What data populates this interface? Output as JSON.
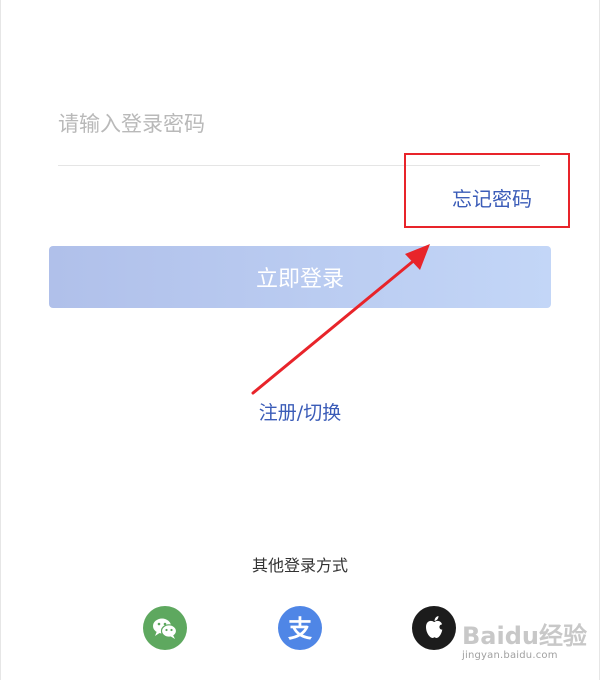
{
  "password": {
    "placeholder": "请输入登录密码",
    "value": ""
  },
  "forgot_password": {
    "label": "忘记密码"
  },
  "login_button": {
    "label": "立即登录"
  },
  "register_switch": {
    "label": "注册/切换"
  },
  "other_login": {
    "title": "其他登录方式",
    "methods": [
      {
        "name": "wechat",
        "icon": "wechat-icon",
        "color": "#5ea85f"
      },
      {
        "name": "alipay",
        "icon": "alipay-icon",
        "color": "#4f86e6"
      },
      {
        "name": "apple",
        "icon": "apple-icon",
        "color": "#1c1c1c"
      }
    ]
  },
  "annotation": {
    "box_color": "#e8242a",
    "arrow_color": "#e8242a"
  },
  "watermark": {
    "logo": "Baidu经验",
    "url": "jingyan.baidu.com"
  },
  "colors": {
    "link": "#3b5cb8",
    "button_start": "#b0c0ea",
    "button_end": "#c3d6f7"
  }
}
